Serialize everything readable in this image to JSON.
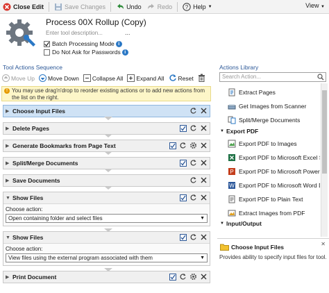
{
  "toolbar": {
    "close_edit": "Close Edit",
    "save_changes": "Save Changes",
    "undo": "Undo",
    "redo": "Redo",
    "help": "Help",
    "view": "View"
  },
  "tool": {
    "title": "Process 00X Rollup (Copy)",
    "desc_placeholder": "Enter tool description...",
    "dots": "...",
    "batch_mode": "Batch Processing Mode",
    "batch_checked": true,
    "no_ask_pw": "Do Not Ask for Passwords",
    "no_ask_checked": false
  },
  "sequence": {
    "title": "Tool Actions Sequence",
    "move_up": "Move Up",
    "move_down": "Move Down",
    "collapse_all": "Collapse All",
    "expand_all": "Expand All",
    "reset": "Reset",
    "hint": "You may use drag'n'drop to reorder existing actions or to add new actions from the list on the right.",
    "actions": [
      {
        "name": "Choose Input Files"
      },
      {
        "name": "Delete Pages"
      },
      {
        "name": "Generate Bookmarks from Page Text"
      },
      {
        "name": "Split/Merge Documents"
      },
      {
        "name": "Save Documents"
      },
      {
        "name": "Show Files",
        "label": "Choose action:",
        "value": "Open containing folder and select files"
      },
      {
        "name": "Show Files",
        "label": "Choose action:",
        "value": "View files using the external program associated with them"
      },
      {
        "name": "Print Document"
      }
    ]
  },
  "library": {
    "title": "Actions Library",
    "search_placeholder": "Search Action...",
    "items1": [
      "Extract Pages",
      "Get Images from Scanner",
      "Split/Merge Documents"
    ],
    "group_export": "Export PDF",
    "export_items": [
      "Export PDF to Images",
      "Export PDF to Microsoft Excel Spread",
      "Export PDF to Microsoft PowerPoint",
      "Export PDF to Microsoft Word Docu",
      "Export PDF to Plain Text",
      "Extract Images from PDF"
    ],
    "group_io": "Input/Output"
  },
  "description": {
    "title": "Choose Input Files",
    "text": "Provides ability to specify input files for tool."
  }
}
